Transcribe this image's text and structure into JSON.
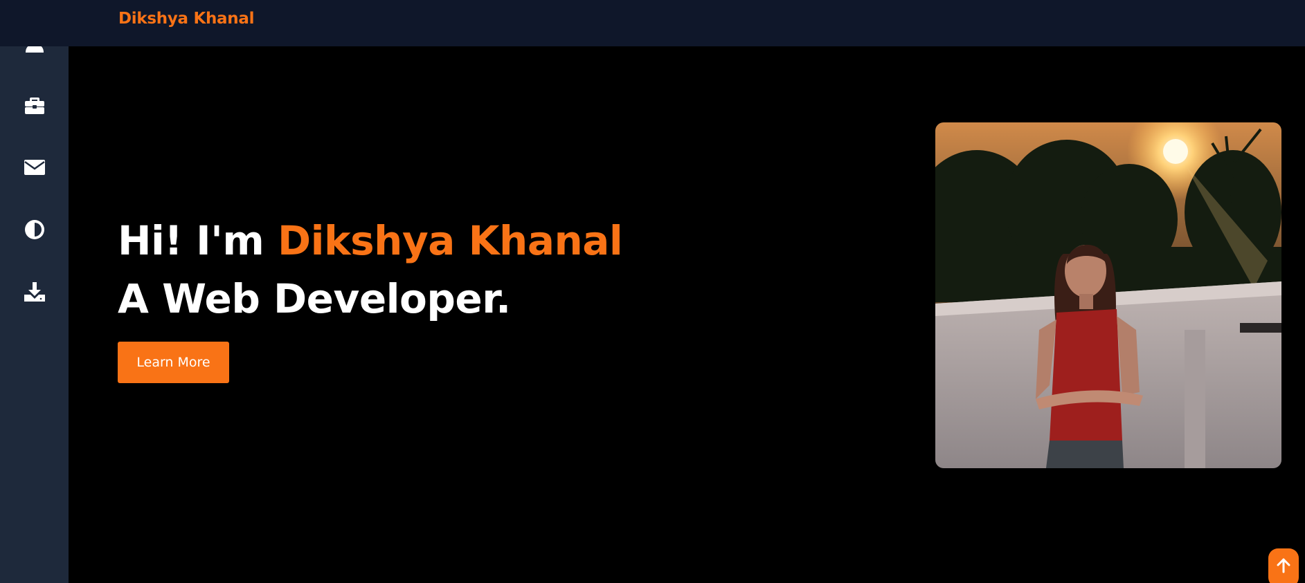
{
  "header": {
    "brand_name": "Dikshya Khanal"
  },
  "sidebar": {
    "items": [
      {
        "icon": "user-icon"
      },
      {
        "icon": "briefcase-icon"
      },
      {
        "icon": "mail-icon"
      },
      {
        "icon": "contrast-icon"
      },
      {
        "icon": "download-icon"
      }
    ]
  },
  "hero": {
    "greeting": "Hi! I'm ",
    "name": "Dikshya Khanal",
    "role": "A Web Developer.",
    "cta_label": "Learn More",
    "photo_alt": "profile-photo"
  },
  "scroll_top": {
    "icon": "arrow-up-icon"
  },
  "colors": {
    "accent": "#f97316",
    "sidebar_bg": "#1e293b",
    "header_bg": "#0f172a",
    "page_bg": "#000000",
    "text": "#ffffff"
  }
}
